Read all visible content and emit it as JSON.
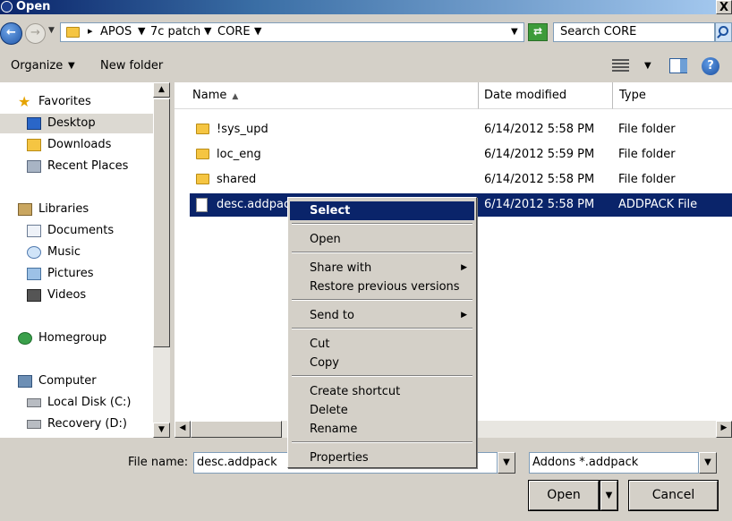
{
  "window": {
    "title": "Open",
    "close_glyph": "X"
  },
  "nav": {
    "back_glyph": "←",
    "forward_glyph": "→",
    "breadcrumbs": [
      "APOS",
      "7c patch",
      "CORE"
    ],
    "search_placeholder": "Search CORE",
    "refresh_glyph": "⇄"
  },
  "toolbar": {
    "organize": "Organize",
    "new_folder": "New folder",
    "help": "?"
  },
  "sidebar": {
    "favorites": "Favorites",
    "desktop": "Desktop",
    "downloads": "Downloads",
    "recent_places": "Recent Places",
    "libraries": "Libraries",
    "documents": "Documents",
    "music": "Music",
    "pictures": "Pictures",
    "videos": "Videos",
    "homegroup": "Homegroup",
    "computer": "Computer",
    "local_disk": "Local Disk (C:)",
    "recovery": "Recovery (D:)"
  },
  "columns": {
    "name": "Name",
    "date": "Date modified",
    "type": "Type"
  },
  "files": [
    {
      "name": "!sys_upd",
      "date": "6/14/2012 5:58 PM",
      "type": "File folder"
    },
    {
      "name": "loc_eng",
      "date": "6/14/2012 5:59 PM",
      "type": "File folder"
    },
    {
      "name": "shared",
      "date": "6/14/2012 5:58 PM",
      "type": "File folder"
    },
    {
      "name": "desc.addpack",
      "date": "6/14/2012 5:58 PM",
      "type": "ADDPACK File"
    }
  ],
  "context_menu": {
    "select": "Select",
    "open": "Open",
    "share_with": "Share with",
    "restore": "Restore previous versions",
    "send_to": "Send to",
    "cut": "Cut",
    "copy": "Copy",
    "create_shortcut": "Create shortcut",
    "delete": "Delete",
    "rename": "Rename",
    "properties": "Properties"
  },
  "bottom": {
    "file_name_label": "File name:",
    "file_name_value": "desc.addpack",
    "filter_value": "Addons *.addpack",
    "open_button": "Open",
    "cancel_button": "Cancel"
  }
}
